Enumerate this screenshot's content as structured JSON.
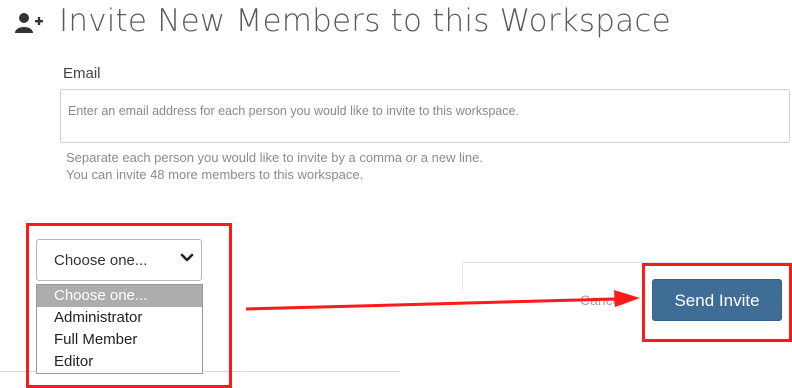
{
  "header": {
    "icon": "add-user-icon",
    "title": "Invite New Members to this Workspace"
  },
  "email": {
    "label": "Email",
    "placeholder": "Enter an email address for each person you would like to invite to this workspace.",
    "help_line1": "Separate each person you would like to invite by a comma or a new line.",
    "help_line2": "You can invite 48 more members to this workspace."
  },
  "role_select": {
    "selected": "Choose one...",
    "icon": "chevron-down-icon",
    "options": [
      "Choose one...",
      "Administrator",
      "Full Member",
      "Editor"
    ]
  },
  "actions": {
    "cancel_label": "Cancel",
    "send_label": "Send Invite"
  },
  "colors": {
    "primary_button": "#3f6d96",
    "annotation_red": "#ff1a1a",
    "highlight_option": "#adadad"
  }
}
